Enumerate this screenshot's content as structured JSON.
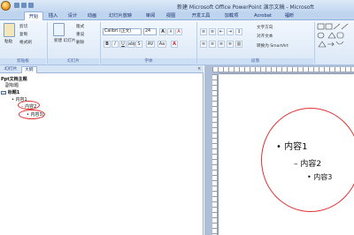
{
  "window": {
    "title": "新建 Microsoft Office PowerPoint 演示文稿 - Microsoft"
  },
  "tabs": [
    "开始",
    "插入",
    "设计",
    "动画",
    "幻灯片放映",
    "审阅",
    "视图",
    "开发工具",
    "加载项",
    "Acrobat",
    "福昕"
  ],
  "ribbon": {
    "clipboard": {
      "paste": "粘贴",
      "cut": "剪切",
      "copy": "复制",
      "format_painter": "格式刷",
      "label": "剪贴板"
    },
    "slides": {
      "new_slide": "新建\n幻灯片",
      "layout": "版式",
      "reset": "重设",
      "delete": "删除",
      "label": "幻灯片"
    },
    "font": {
      "name": "Calibri (正文)",
      "size": "24",
      "grow": "A",
      "shrink": "A",
      "clear": "A",
      "label": "字体"
    },
    "paragraph": {
      "text_direction": "文字方向",
      "align_text": "对齐文本",
      "smartart": "转换为 SmartArt",
      "label": "段落"
    }
  },
  "pane": {
    "tabs": [
      "幻灯片",
      "大纲"
    ],
    "close": "×"
  },
  "outline": {
    "slide1_title": "Ppt文档主题",
    "slide1_subtitle": "副标题",
    "slide2_title": "标题1",
    "items": [
      "内容1",
      "内容2",
      "内容3"
    ]
  },
  "slide": {
    "items": [
      "内容1",
      "内容2",
      "内容3"
    ]
  }
}
